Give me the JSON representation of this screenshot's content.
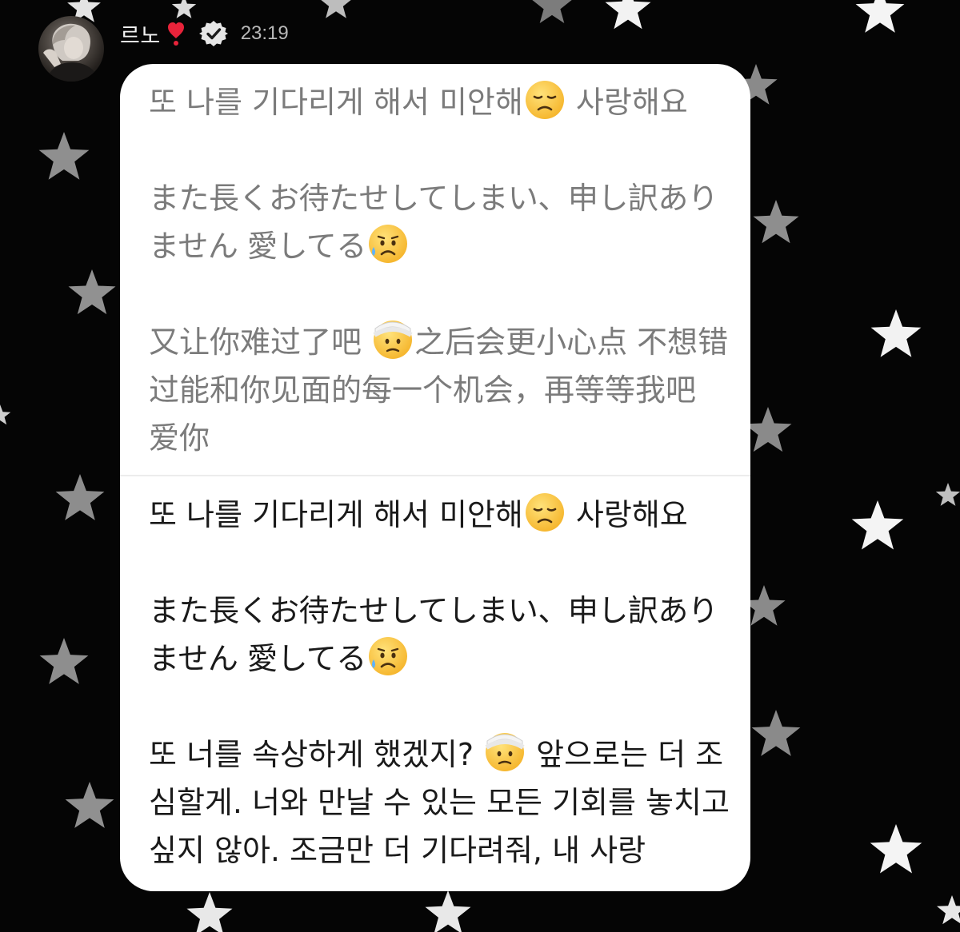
{
  "header": {
    "username": "르노",
    "heart_icon": "red-exclamation-heart",
    "verified_icon": "verified-badge",
    "timestamp": "23:19"
  },
  "message": {
    "original": {
      "ko": {
        "text": "또 나를 기다리게 해서 미안해",
        "emoji": "disappointed-face",
        "tail": " 사랑해요"
      },
      "ja": {
        "text": "また長くお待たせしてしまい、申し訳ありません 愛してる",
        "emoji": "sad-sweat-face",
        "tail": ""
      },
      "zh": {
        "text": "又让你难过了吧 ",
        "emoji": "bandaged-head-face",
        "tail": "之后会更小心点 不想错过能和你见面的每一个机会，再等等我吧 爱你"
      }
    },
    "translated": {
      "ko": {
        "text": "또 나를 기다리게 해서 미안해",
        "emoji": "disappointed-face",
        "tail": " 사랑해요"
      },
      "ja": {
        "text": "また長くお待たせしてしまい、申し訳ありません 愛してる",
        "emoji": "sad-sweat-face",
        "tail": ""
      },
      "ko2": {
        "text": "또 너를 속상하게 했겠지? ",
        "emoji": "bandaged-head-face",
        "tail": " 앞으로는 더 조심할게. 너와 만날 수 있는 모든 기회를 놓치고 싶지 않아. 조금만 더 기다려줘, 내 사랑"
      }
    }
  },
  "colors": {
    "background": "#050505",
    "bubble": "#ffffff",
    "original_text": "#7b7b7b",
    "translated_text": "#1a1a1a",
    "timestamp": "#b9b9b9"
  }
}
